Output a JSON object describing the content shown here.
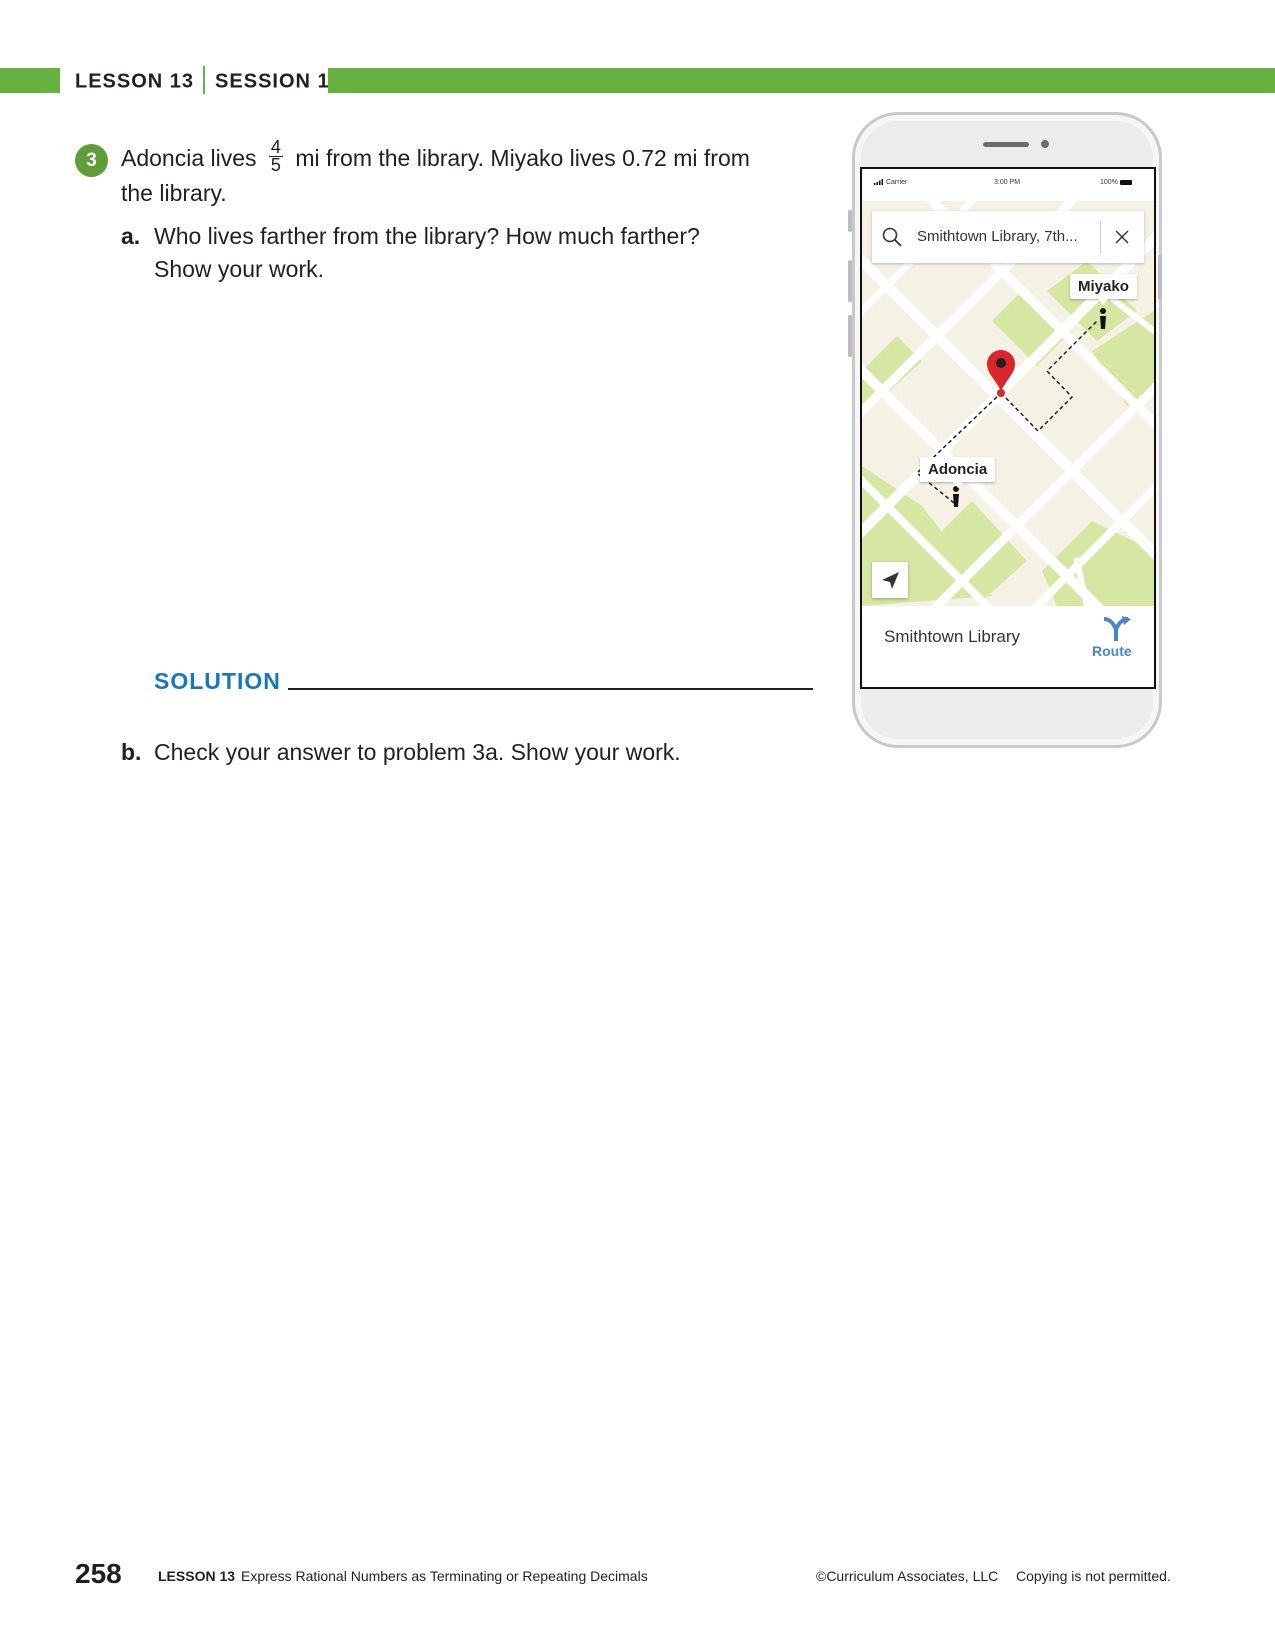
{
  "header": {
    "lesson": "LESSON 13",
    "session": "SESSION 1",
    "accent_color": "#67b13f"
  },
  "problem": {
    "number": "3",
    "stem_before": "Adoncia lives",
    "fraction_numerator": "4",
    "fraction_denominator": "5",
    "stem_after": "mi from the library. Miyako lives 0.72 mi from the library.",
    "part_a": {
      "label": "a.",
      "text": "Who lives farther from the library? How much farther? Show your work."
    },
    "solution_label": "SOLUTION",
    "part_b": {
      "label": "b.",
      "text": "Check your answer to problem 3a. Show your work."
    }
  },
  "phone": {
    "status": {
      "carrier": "Carrier",
      "time": "3:00 PM",
      "battery": "100%"
    },
    "search_text": "Smithtown Library, 7th...",
    "search_icon": "search-icon",
    "clear_icon": "close-icon",
    "callouts": {
      "miyako": "Miyako",
      "adoncia": "Adoncia"
    },
    "destination": "Smithtown Library",
    "route_label": "Route",
    "map_colors": {
      "land": "#f6f1e5",
      "park": "#d6e6a3",
      "road": "#ffffff",
      "pin": "#d9252b",
      "route_accent": "#4a86c5"
    }
  },
  "footer": {
    "page_number": "258",
    "lesson": "LESSON 13",
    "title": "Express Rational Numbers as Terminating or Repeating Decimals",
    "copyright": "©Curriculum Associates, LLC",
    "notice": "Copying is not permitted."
  }
}
